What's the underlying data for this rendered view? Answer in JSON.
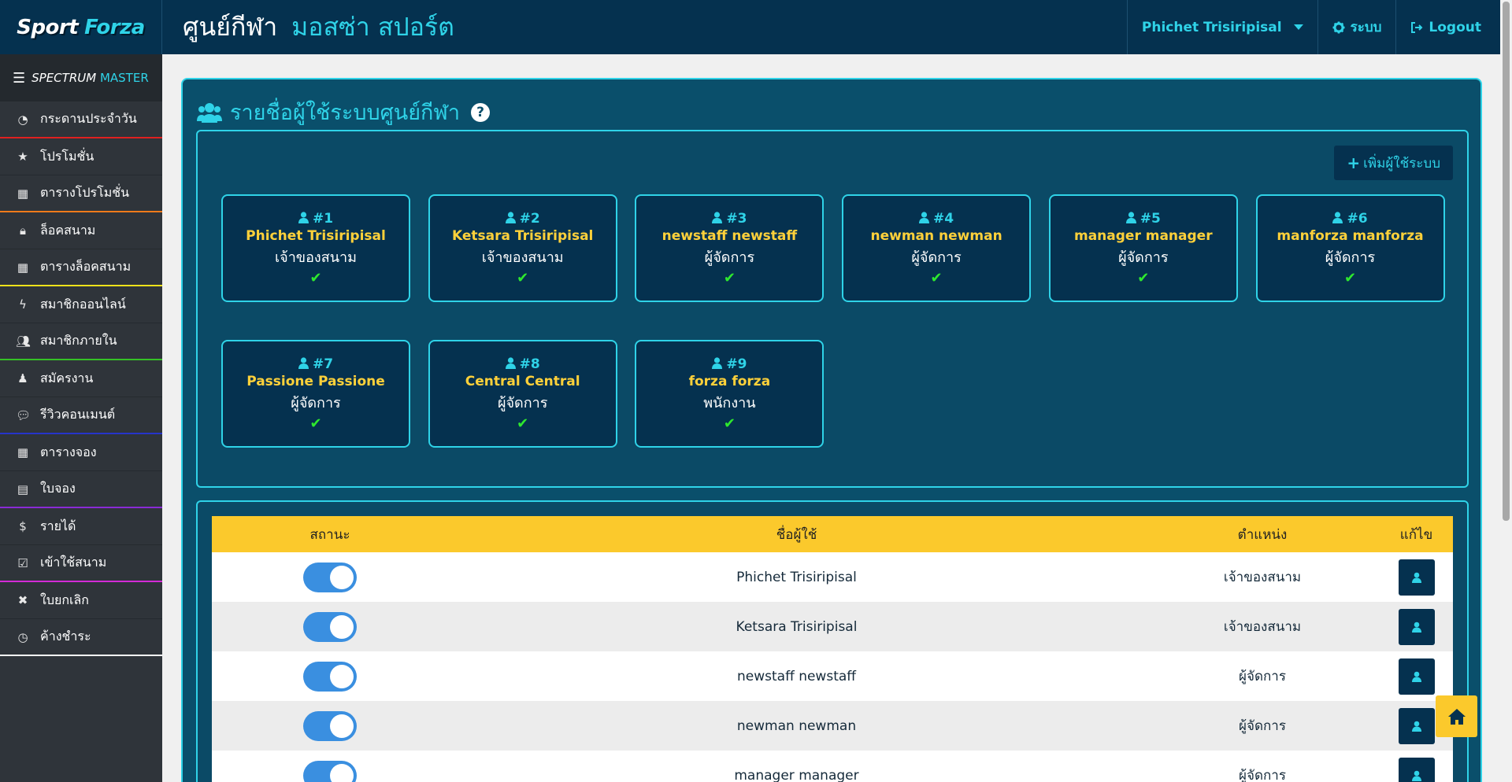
{
  "brand": {
    "part1": "Sport",
    "part2": "Forza"
  },
  "header": {
    "title": "ศูนย์กีฬา",
    "venue": "มอสซ่า สปอร์ต"
  },
  "nav": {
    "user": "Phichet Trisiripisal",
    "system": "ระบบ",
    "logout": "Logout"
  },
  "sidebar": {
    "header_a": "SPECTRUM",
    "header_b": "MASTER",
    "items": [
      {
        "label": "กระดานประจำวัน",
        "icon": "dashboard-icon",
        "accent": "#e02020"
      },
      {
        "label": "โปรโมชั่น",
        "icon": "star-icon",
        "accent": ""
      },
      {
        "label": "ตารางโปรโมชั่น",
        "icon": "table-icon",
        "accent": "#f07a1a"
      },
      {
        "label": "ล็อคสนาม",
        "icon": "lock-icon",
        "accent": ""
      },
      {
        "label": "ตารางล็อคสนาม",
        "icon": "table-icon",
        "accent": "#f2e21a"
      },
      {
        "label": "สมาชิกออนไลน์",
        "icon": "bolt-icon",
        "accent": ""
      },
      {
        "label": "สมาชิกภายใน",
        "icon": "users-icon",
        "accent": "#35c226"
      },
      {
        "label": "สมัครงาน",
        "icon": "user-tie-icon",
        "accent": ""
      },
      {
        "label": "รีวิวคอนเมนต์",
        "icon": "comments-icon",
        "accent": "#2634c9"
      },
      {
        "label": "ตารางจอง",
        "icon": "table-icon",
        "accent": ""
      },
      {
        "label": "ใบจอง",
        "icon": "book-icon",
        "accent": "#8a2bd6"
      },
      {
        "label": "รายได้",
        "icon": "dollar-icon",
        "accent": ""
      },
      {
        "label": "เข้าใช้สนาม",
        "icon": "check-square-icon",
        "accent": "#d42bd6"
      },
      {
        "label": "ใบยกเลิก",
        "icon": "times-icon",
        "accent": ""
      },
      {
        "label": "ค้างชำระ",
        "icon": "clock-icon",
        "accent": "#ffffff"
      }
    ]
  },
  "panel": {
    "title": "รายชื่อผู้ใช้ระบบศูนย์กีฬา",
    "help": "?",
    "add_label": "เพิ่มผู้ใช้ระบบ"
  },
  "cards": [
    {
      "num": "#1",
      "name": "Phichet Trisiripisal",
      "role": "เจ้าของสนาม"
    },
    {
      "num": "#2",
      "name": "Ketsara Trisiripisal",
      "role": "เจ้าของสนาม"
    },
    {
      "num": "#3",
      "name": "newstaff newstaff",
      "role": "ผู้จัดการ"
    },
    {
      "num": "#4",
      "name": "newman newman",
      "role": "ผู้จัดการ"
    },
    {
      "num": "#5",
      "name": "manager manager",
      "role": "ผู้จัดการ"
    },
    {
      "num": "#6",
      "name": "manforza manforza",
      "role": "ผู้จัดการ"
    },
    {
      "num": "#7",
      "name": "Passione Passione",
      "role": "ผู้จัดการ"
    },
    {
      "num": "#8",
      "name": "Central Central",
      "role": "ผู้จัดการ"
    },
    {
      "num": "#9",
      "name": "forza forza",
      "role": "พนักงาน"
    }
  ],
  "table": {
    "headers": [
      "สถานะ",
      "ชื่อผู้ใช้",
      "ตำแหน่ง",
      "แก้ไข"
    ],
    "rows": [
      {
        "name": "Phichet Trisiripisal",
        "role": "เจ้าของสนาม",
        "active": true
      },
      {
        "name": "Ketsara Trisiripisal",
        "role": "เจ้าของสนาม",
        "active": true
      },
      {
        "name": "newstaff newstaff",
        "role": "ผู้จัดการ",
        "active": true
      },
      {
        "name": "newman newman",
        "role": "ผู้จัดการ",
        "active": true
      },
      {
        "name": "manager manager",
        "role": "ผู้จัดการ",
        "active": true
      }
    ]
  },
  "colors": {
    "navy": "#05314f",
    "cyan": "#2fd3e8",
    "yellow": "#fbc92c",
    "panel": "#0a4f6b",
    "check": "#2ee82e"
  }
}
